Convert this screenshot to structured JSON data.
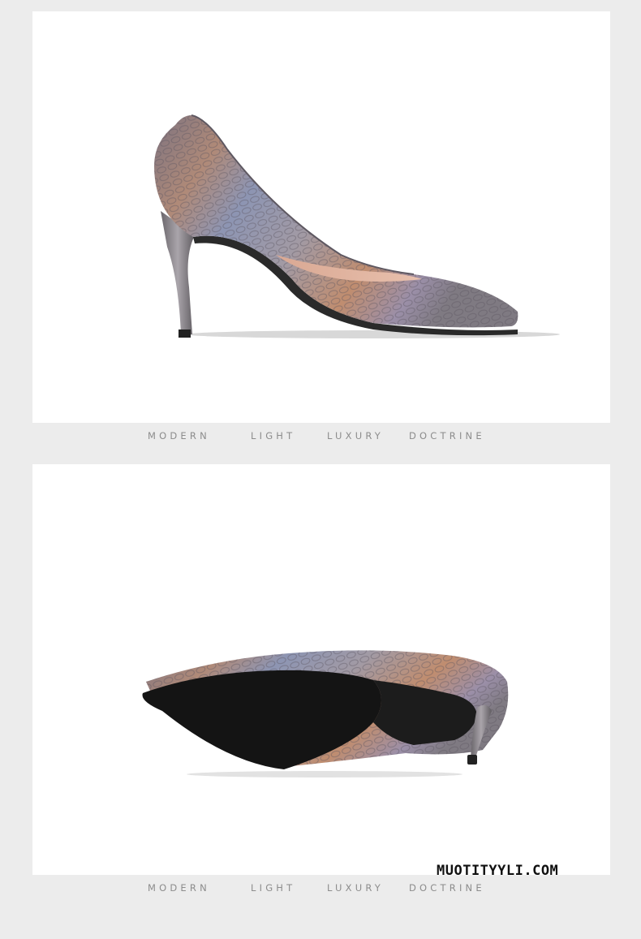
{
  "captions": {
    "top": {
      "w1": "MODERN",
      "w2": "LIGHT",
      "w3": "LUXURY",
      "w4": "DOCTRINE"
    },
    "bottom": {
      "w1": "MODERN",
      "w2": "LIGHT",
      "w3": "LUXURY",
      "w4": "DOCTRINE"
    }
  },
  "watermark": "MUOTITYYLI.COM",
  "colors": {
    "background": "#ececec",
    "panel": "#ffffff",
    "caption": "#8c8c8c",
    "shoe_base": "#8f8790",
    "sole": "#141414"
  }
}
